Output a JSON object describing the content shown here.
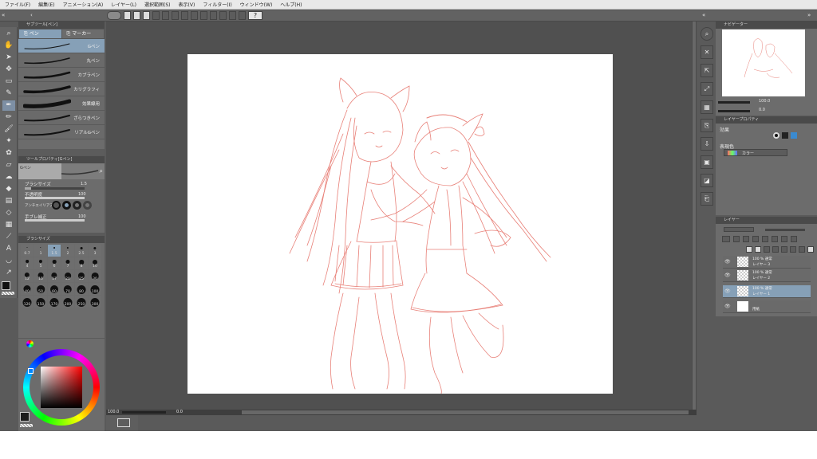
{
  "menu": [
    "ファイル(F)",
    "編集(E)",
    "アニメーション(A)",
    "レイヤー(L)",
    "選択範囲(S)",
    "表示(V)",
    "フィルター(I)",
    "ウィンドウ(W)",
    "ヘルプ(H)"
  ],
  "subtool": {
    "header": "サブツール[ペン]",
    "tab_pen": "ペン",
    "tab_marker": "マーカー",
    "brushes": [
      "Gペン",
      "丸ペン",
      "カブラペン",
      "カリグラフィ",
      "効果線用",
      "ざらつきペン",
      "リアルGペン"
    ]
  },
  "toolprop": {
    "header": "ツールプロパティ[Gペン]",
    "name": "Gペン",
    "brush_size_label": "ブラシサイズ",
    "brush_size_value": "1.5",
    "opacity_label": "不透明度",
    "opacity_value": "100",
    "antialias_label": "アンチエイリアス",
    "stabilize_label": "手ブレ補正",
    "stabilize_value": "100"
  },
  "brushsize": {
    "header": "ブラシサイズ",
    "sizes": [
      "0.7",
      "1",
      "1.5",
      "2",
      "2.5",
      "3",
      "4",
      "5",
      "6",
      "7",
      "8",
      "10",
      "12",
      "15",
      "17",
      "20",
      "25",
      "30",
      "40",
      "50",
      "60",
      "70",
      "80",
      "100",
      "120",
      "150",
      "170",
      "200",
      "250",
      "300"
    ]
  },
  "navigator": {
    "header": "ナビゲーター",
    "zoom": "100.0",
    "angle": "0.0"
  },
  "layerprop": {
    "header": "レイヤープロパティ",
    "effect_label": "効果",
    "color_label": "表現色",
    "color_value": "カラー"
  },
  "layers": {
    "header": "レイヤー",
    "items": [
      {
        "blend": "100 % 通常",
        "name": "レイヤー 3"
      },
      {
        "blend": "100 % 通常",
        "name": "レイヤー 2"
      },
      {
        "blend": "100 % 通常",
        "name": "レイヤー 1"
      },
      {
        "blend": "",
        "name": "用紙"
      }
    ]
  },
  "status": {
    "zoom": "100.0",
    "angle": "0.0"
  },
  "colors": {
    "accent": "#86a0b7",
    "sketch": "#e88078",
    "ui_bg": "#5a5a5a",
    "canvas_bg": "#505050"
  }
}
